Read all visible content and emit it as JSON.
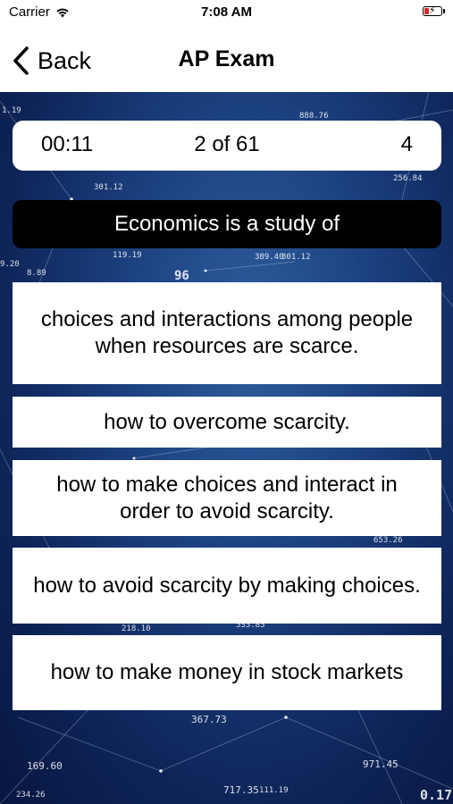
{
  "status_bar": {
    "carrier": "Carrier",
    "time": "7:08 AM"
  },
  "nav": {
    "back_label": "Back",
    "title": "AP Exam"
  },
  "quiz": {
    "timer": "00:11",
    "progress": "2 of 61",
    "score": "4",
    "question": "Economics is a study of",
    "answers": [
      "choices and interactions among people when resources are scarce.",
      "how to overcome scarcity.",
      "how to make choices and interact in order to avoid scarcity.",
      "how to avoid scarcity by making choices.",
      "how to make money in stock markets"
    ]
  },
  "background_numbers": [
    "1.19",
    "888.76",
    "256.84",
    "301.12",
    "119.19",
    "389.40",
    "301.12",
    "9.20",
    "8.89",
    "96",
    "653.26",
    "218.10",
    "533.83",
    "367.73",
    "169.60",
    "971.45",
    "717.35",
    "111.19",
    "234.26",
    "0.17"
  ],
  "colors": {
    "background_dark": "#0e2559",
    "background_light": "#2f5d9e",
    "question_bg": "#000000",
    "card_bg": "#ffffff",
    "battery_level": "#e0262b"
  }
}
